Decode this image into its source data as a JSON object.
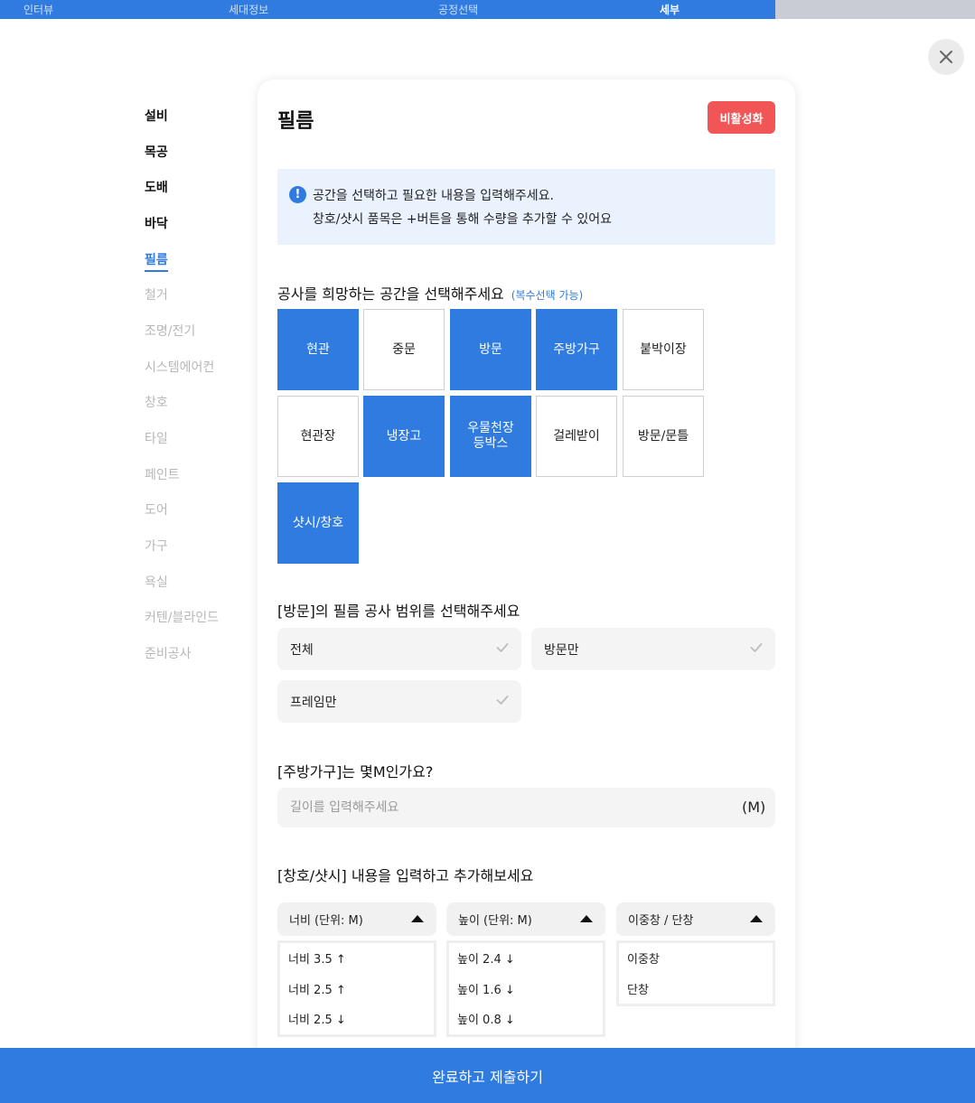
{
  "progress": {
    "steps": [
      "인터뷰",
      "세대정보",
      "공정선택",
      "세부"
    ],
    "active_step": "세부",
    "completed_fraction": 0.795
  },
  "sidebar": {
    "items": [
      {
        "label": "설비",
        "state": "done"
      },
      {
        "label": "목공",
        "state": "done"
      },
      {
        "label": "도배",
        "state": "done"
      },
      {
        "label": "바닥",
        "state": "done"
      },
      {
        "label": "필름",
        "state": "current"
      },
      {
        "label": "철거",
        "state": "todo"
      },
      {
        "label": "조명/전기",
        "state": "todo"
      },
      {
        "label": "시스템에어컨",
        "state": "todo"
      },
      {
        "label": "창호",
        "state": "todo"
      },
      {
        "label": "타일",
        "state": "todo"
      },
      {
        "label": "페인트",
        "state": "todo"
      },
      {
        "label": "도어",
        "state": "todo"
      },
      {
        "label": "가구",
        "state": "todo"
      },
      {
        "label": "욕실",
        "state": "todo"
      },
      {
        "label": "커텐/블라인드",
        "state": "todo"
      },
      {
        "label": "준비공사",
        "state": "todo"
      }
    ]
  },
  "card": {
    "title": "필름",
    "deactivate_label": "비활성화",
    "info": {
      "line1": "공간을 선택하고 필요한 내용을 입력해주세요.",
      "line2": "창호/샷시 품목은 +버튼을 통해 수량을 추가할 수 있어요"
    },
    "space_question": "공사를 희망하는 공간을 선택해주세요",
    "space_hint": "(복수선택 가능)",
    "spaces": [
      {
        "label": "현관",
        "selected": true
      },
      {
        "label": "중문",
        "selected": false
      },
      {
        "label": "방문",
        "selected": true
      },
      {
        "label": "주방가구",
        "selected": true
      },
      {
        "label": "붙박이장",
        "selected": false
      },
      {
        "label": "현관장",
        "selected": false
      },
      {
        "label": "냉장고",
        "selected": true
      },
      {
        "label": "우물천장\n등박스",
        "selected": true
      },
      {
        "label": "걸레받이",
        "selected": false
      },
      {
        "label": "방문/문틀",
        "selected": false
      },
      {
        "label": "샷시/창호",
        "selected": true
      }
    ],
    "door_question": "[방문]의 필름 공사 범위를 선택해주세요",
    "door_options": [
      "전체",
      "방문만",
      "프레임만"
    ],
    "kitchen_question": "[주방가구]는 몇M인가요?",
    "kitchen_placeholder": "길이를 입력해주세요",
    "kitchen_unit": "(M)",
    "window_question": "[창호/샷시] 내용을 입력하고 추가해보세요",
    "width_dropdown": {
      "label": "너비 (단위: M)",
      "options": [
        "너비 3.5 ↑",
        "너비 2.5 ↑",
        "너비 2.5 ↓"
      ]
    },
    "height_dropdown": {
      "label": "높이 (단위: M)",
      "options": [
        "높이 2.4 ↓",
        "높이 1.6 ↓",
        "높이 0.8 ↓"
      ]
    },
    "type_dropdown": {
      "label": "이중창 / 단창",
      "options": [
        "이중창",
        "단창"
      ]
    }
  },
  "submit_label": "완료하고 제출하기",
  "colors": {
    "accent": "#2f7be0",
    "danger": "#f25555",
    "info_bg": "#e9f2fd"
  }
}
